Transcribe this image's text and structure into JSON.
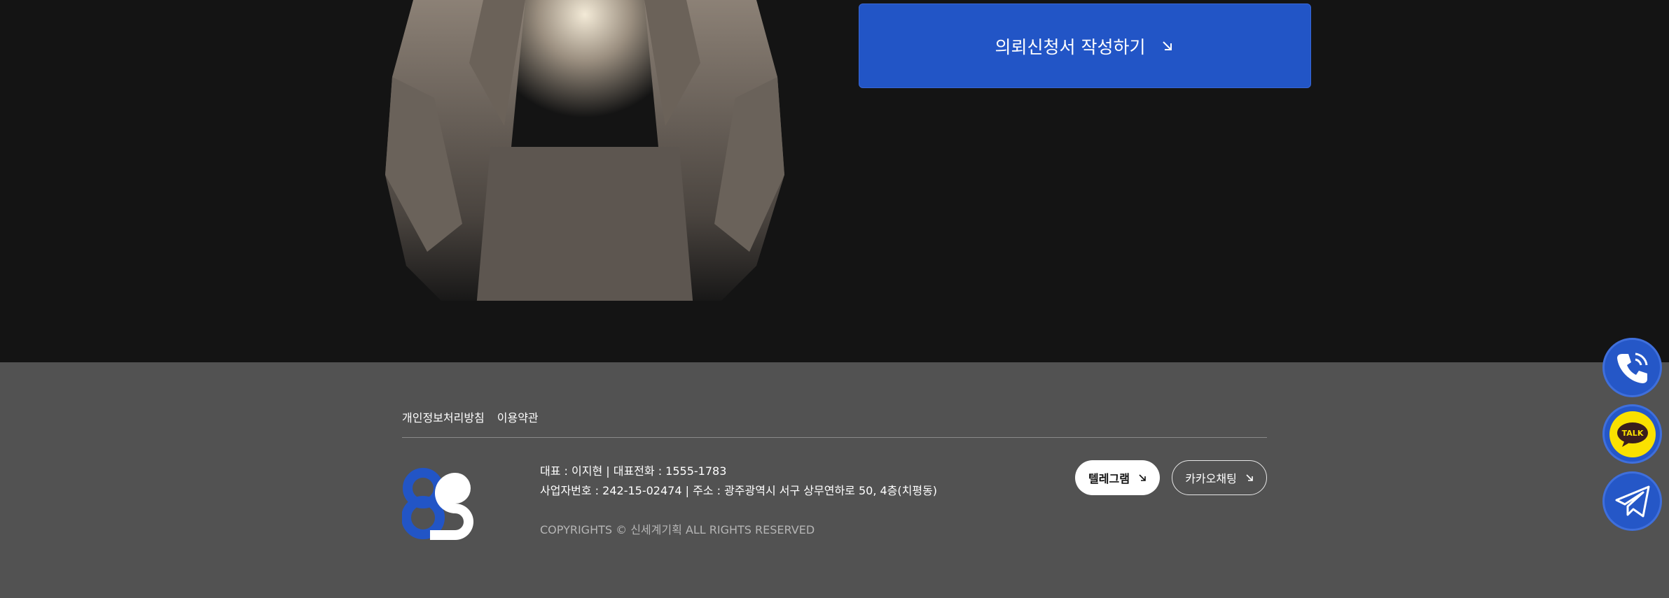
{
  "hero": {
    "cta_label": "의뢰신청서 작성하기"
  },
  "footer": {
    "links": [
      "개인정보처리방침",
      "이용약관"
    ],
    "info_line1": "대표 : 이지현 | 대표전화 : 1555-1783",
    "info_line2": "사업자번호 : 242-15-02474 | 주소 : 광주광역시 서구 상무연하로 50, 4층(치평동)",
    "copyright": "COPYRIGHTS © 신세계기획 ALL RIGHTS RESERVED",
    "telegram_label": "텔레그램",
    "kakao_label": "카카오채팅"
  },
  "floating": {
    "talk_label": "TALK"
  },
  "colors": {
    "accent": "#2255c6",
    "footer_bg": "#525252",
    "page_bg": "#141414",
    "kakao_yellow": "#fae100"
  },
  "icons": [
    "arrow-down-right-icon",
    "phone-icon",
    "kakao-talk-icon",
    "telegram-icon",
    "company-logo"
  ]
}
